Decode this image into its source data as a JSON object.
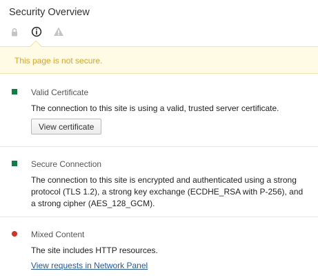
{
  "header": {
    "title": "Security Overview",
    "tabs": [
      {
        "icon": "lock-icon",
        "selected": false
      },
      {
        "icon": "info-icon",
        "selected": true
      },
      {
        "icon": "warning-icon",
        "selected": false
      }
    ]
  },
  "summary": {
    "text": "This page is not secure.",
    "color": "#e0a125"
  },
  "sections": [
    {
      "heading": "Valid Certificate",
      "status": "secure",
      "status_color": "#0b8043",
      "description": "The connection to this site is using a valid, trusted server certificate.",
      "button_label": "View certificate"
    },
    {
      "heading": "Secure Connection",
      "status": "secure",
      "status_color": "#0b8043",
      "description": "The connection to this site is encrypted and authenticated using a strong protocol (TLS 1.2), a strong key exchange (ECDHE_RSA with P-256), and a strong cipher (AES_128_GCM)."
    },
    {
      "heading": "Mixed Content",
      "status": "insecure",
      "status_color": "#d93025",
      "description": "The site includes HTTP resources.",
      "link_label": "View requests in Network Panel"
    }
  ]
}
